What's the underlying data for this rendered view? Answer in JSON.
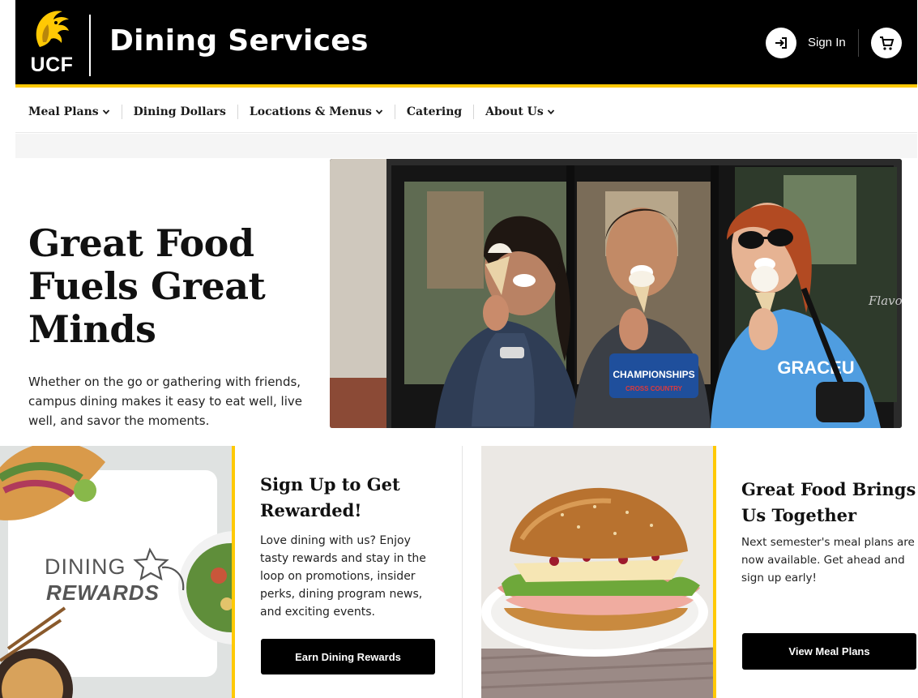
{
  "header": {
    "logo_text": "UCF",
    "title": "Dining Services",
    "sign_in_label": "Sign In",
    "sign_in_icon": "sign-in-arrow-icon",
    "cart_icon": "shopping-cart-icon"
  },
  "nav": {
    "items": [
      {
        "label": "Meal Plans",
        "has_dropdown": true
      },
      {
        "label": "Dining Dollars",
        "has_dropdown": false
      },
      {
        "label": "Locations & Menus",
        "has_dropdown": true
      },
      {
        "label": "Catering",
        "has_dropdown": false
      },
      {
        "label": "About Us",
        "has_dropdown": true
      }
    ]
  },
  "hero": {
    "title_line1": "Great Food",
    "title_line2": "Fuels Great",
    "title_line3": "Minds",
    "subtitle": "Whether on the go or gathering with friends, campus dining makes it easy to eat well, live well, and savor the moments.",
    "photo_shirt_text_center": "CHAMPIONSHIPS",
    "photo_shirt_subtext_center": "CROSS COUNTRY",
    "photo_shirt_text_right": "GRACEU",
    "photo_window_text": "Flavor"
  },
  "promo_left": {
    "badge_line1": "DINING",
    "badge_line2": "REWARDS",
    "title": "Sign Up to Get Rewarded!",
    "description": "Love dining with us? Enjoy tasty rewards and stay in the loop on promotions, insider perks, dining program news, and exciting events.",
    "button_label": "Earn Dining Rewards"
  },
  "promo_right": {
    "title": "Great Food Brings Us Together",
    "description": "Next semester's meal plans are now available. Get ahead and sign up early!",
    "button_label": "View Meal Plans"
  },
  "colors": {
    "brand_gold": "#ffc904",
    "header_bg": "#000000",
    "button_bg": "#000000"
  }
}
